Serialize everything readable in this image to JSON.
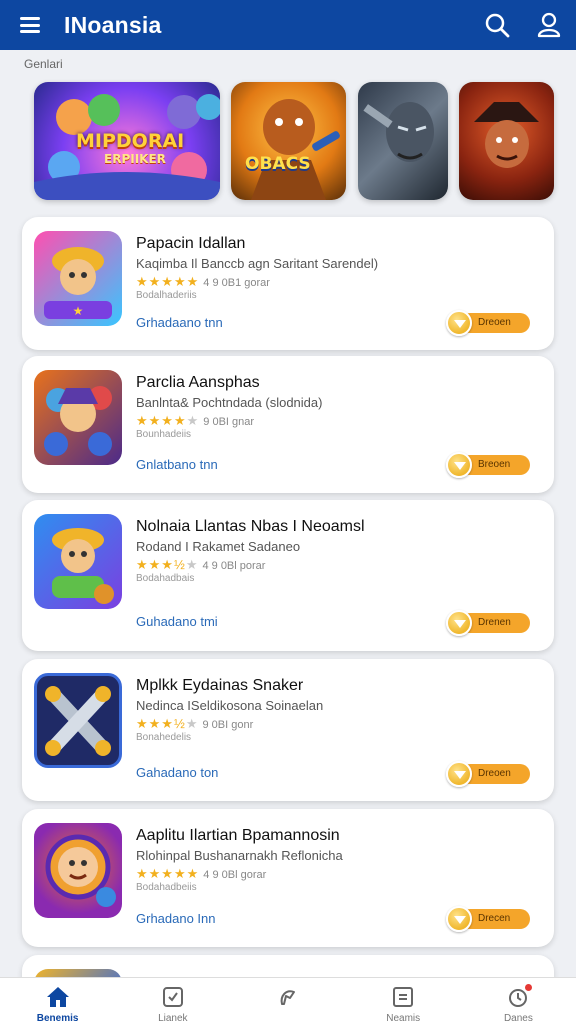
{
  "app": {
    "title": "INoansia"
  },
  "header": {
    "menu_icon": "hamburger-menu-icon",
    "search_icon": "search-icon",
    "user_icon": "user-icon"
  },
  "featured": {
    "label": "Genlari",
    "banners": [
      {
        "text": "MIPDORAI",
        "subtext": "ERPIIKER"
      },
      {
        "text": "OBACS"
      },
      {
        "text": ""
      },
      {
        "text": ""
      }
    ]
  },
  "apps": [
    {
      "name": "Papacin Idallan",
      "desc": "Kaqimba Il Banccb agn Saritant Sarendel)",
      "rating": 5,
      "count": "4 9 0B1 gorar",
      "meta": "Bodalhaderiis",
      "link": "Grhadaano tnn",
      "cta": "Dreoen"
    },
    {
      "name": "Parclia Aansphas",
      "desc": "Banlnta& Pochtndada (slodnida)",
      "rating": 4,
      "count": "9 0BI gnar",
      "meta": "Bounhadeiis",
      "link": "Gnlatbano tnn",
      "cta": "Breoen"
    },
    {
      "name": "Nolnaia Llantas Nbas I Neoamsl",
      "desc": "Rodand I Rakamet Sadaneo",
      "rating": 3.5,
      "count": "4 9 0Bl porar",
      "meta": "Bodahadbais",
      "link": "Guhadano tmi",
      "cta": "Drenen"
    },
    {
      "name": "Mplkk Eydainas Snaker",
      "desc": "Nedinca ISeldikosona Soinaelan",
      "rating": 3.5,
      "count": "9 0BI gonr",
      "meta": "Bonahedelis",
      "link": "Gahadano ton",
      "cta": "Dreoen"
    },
    {
      "name": "Aaplitu Ilartian Bpamannosin",
      "desc": "Rlohinpal Bushanarnakh Reflonicha",
      "rating": 5,
      "count": "4 9 0Bl gorar",
      "meta": "Bodahadbeiis",
      "link": "Grhadano Inn",
      "cta": "Drecen"
    }
  ],
  "nav": [
    {
      "label": "Benemis",
      "icon": "home-icon",
      "active": true
    },
    {
      "label": "Lianek",
      "icon": "checkbox-icon",
      "active": false
    },
    {
      "label": "",
      "icon": "pen-tool-icon",
      "active": false
    },
    {
      "label": "Neamis",
      "icon": "list-box-icon",
      "active": false
    },
    {
      "label": "Danes",
      "icon": "clock-icon",
      "active": false
    }
  ]
}
